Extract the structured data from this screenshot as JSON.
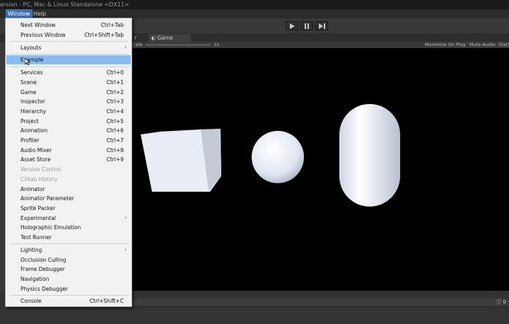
{
  "window_title": "ersion - PC, Mac & Linux Standalone <DX11>",
  "menubar": {
    "items": [
      "Window",
      "Help"
    ]
  },
  "toolbar": {
    "play": "play-icon",
    "pause": "pause-icon",
    "step": "step-icon"
  },
  "tabs": [
    {
      "label": "r"
    },
    {
      "label": "Game"
    }
  ],
  "game_toolbar": {
    "scale_label": "cale",
    "scale_value": "1x",
    "maximize": "Maximize On Play",
    "mute": "Mute Audio",
    "stats": "Stats"
  },
  "console_count": "0",
  "menu": {
    "groups": [
      [
        {
          "label": "Next Window",
          "shortcut": "Ctrl+Tab"
        },
        {
          "label": "Previous Window",
          "shortcut": "Ctrl+Shift+Tab"
        }
      ],
      [
        {
          "label": "Layouts",
          "submenu": true
        }
      ],
      [
        {
          "label": "Example",
          "highlighted": true
        }
      ],
      [
        {
          "label": "Services",
          "shortcut": "Ctrl+0"
        },
        {
          "label": "Scene",
          "shortcut": "Ctrl+1"
        },
        {
          "label": "Game",
          "shortcut": "Ctrl+2"
        },
        {
          "label": "Inspector",
          "shortcut": "Ctrl+3"
        },
        {
          "label": "Hierarchy",
          "shortcut": "Ctrl+4"
        },
        {
          "label": "Project",
          "shortcut": "Ctrl+5"
        },
        {
          "label": "Animation",
          "shortcut": "Ctrl+6"
        },
        {
          "label": "Profiler",
          "shortcut": "Ctrl+7"
        },
        {
          "label": "Audio Mixer",
          "shortcut": "Ctrl+8"
        },
        {
          "label": "Asset Store",
          "shortcut": "Ctrl+9"
        },
        {
          "label": "Version Control",
          "disabled": true
        },
        {
          "label": "Collab History",
          "disabled": true
        },
        {
          "label": "Animator"
        },
        {
          "label": "Animator Parameter"
        },
        {
          "label": "Sprite Packer"
        },
        {
          "label": "Experimental",
          "submenu": true
        },
        {
          "label": "Holographic Emulation"
        },
        {
          "label": "Test Runner"
        }
      ],
      [
        {
          "label": "Lighting",
          "submenu": true
        },
        {
          "label": "Occlusion Culling"
        },
        {
          "label": "Frame Debugger"
        },
        {
          "label": "Navigation"
        },
        {
          "label": "Physics Debugger"
        }
      ],
      [
        {
          "label": "Console",
          "shortcut": "Ctrl+Shift+C"
        }
      ]
    ]
  }
}
